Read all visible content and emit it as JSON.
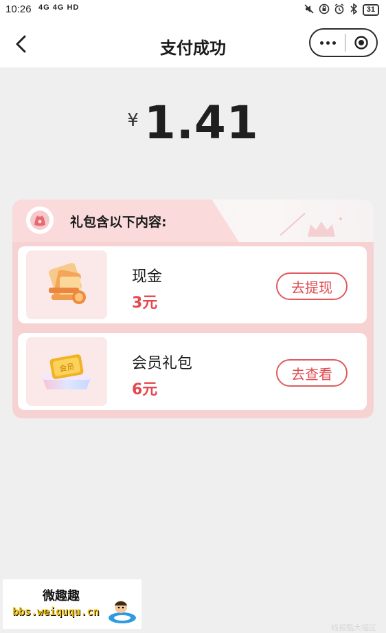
{
  "status_bar": {
    "time": "10:26",
    "network": "4G 4G HD",
    "battery": "31"
  },
  "nav": {
    "title": "支付成功"
  },
  "payment": {
    "currency_symbol": "¥",
    "amount": "1.41"
  },
  "gift": {
    "title": "礼包含以下内容:",
    "items": [
      {
        "name": "现金",
        "value": "3元",
        "button": "去提现",
        "icon": "cash-envelope-icon"
      },
      {
        "name": "会员礼包",
        "value": "6元",
        "button": "去查看",
        "icon": "vip-ticket-icon"
      }
    ]
  },
  "watermark": {
    "title": "微趣趣",
    "url": "bbs.weiququ.cn",
    "corner_text": "线报酷大福区"
  },
  "colors": {
    "accent": "#e4474d",
    "card_bg": "#f6d2d3",
    "page_bg": "#efefef"
  }
}
